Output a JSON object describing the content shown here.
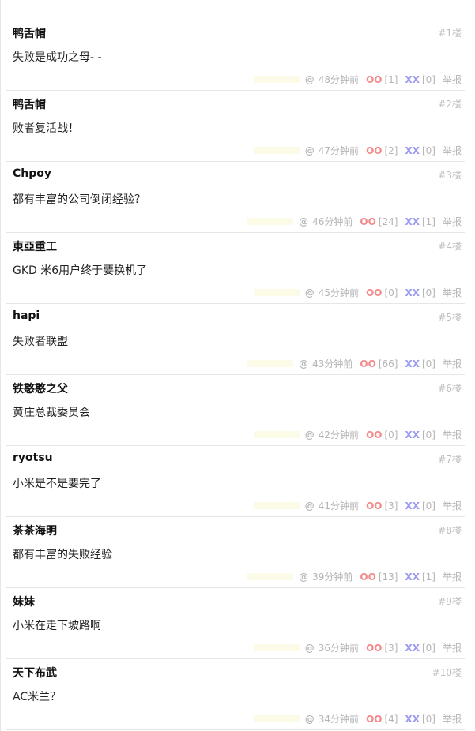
{
  "labels": {
    "report": "举报",
    "at": "@",
    "oo": "OO",
    "xx": "XX"
  },
  "comments": [
    {
      "author": "鸭舌帽",
      "floor": "#1楼",
      "content": "失败是成功之母- -",
      "time": "48分钟前",
      "oo": "[1]",
      "xx": "[0]"
    },
    {
      "author": "鸭舌帽",
      "floor": "#2楼",
      "content": "败者复活战！",
      "time": "47分钟前",
      "oo": "[2]",
      "xx": "[0]"
    },
    {
      "author": "Chpoy",
      "floor": "#3楼",
      "content": "都有丰富的公司倒闭经验？",
      "time": "46分钟前",
      "oo": "[24]",
      "xx": "[1]"
    },
    {
      "author": "東亞重工",
      "floor": "#4楼",
      "content": "GKD 米6用户终于要换机了",
      "time": "45分钟前",
      "oo": "[0]",
      "xx": "[0]"
    },
    {
      "author": "hapi",
      "floor": "#5楼",
      "content": "失败者联盟",
      "time": "43分钟前",
      "oo": "[66]",
      "xx": "[0]"
    },
    {
      "author": "铁憨憨之父",
      "floor": "#6楼",
      "content": "黄庄总裁委员会",
      "time": "42分钟前",
      "oo": "[0]",
      "xx": "[0]"
    },
    {
      "author": "ryotsu",
      "floor": "#7楼",
      "content": "小米是不是要完了",
      "time": "41分钟前",
      "oo": "[3]",
      "xx": "[0]"
    },
    {
      "author": "茶茶海明",
      "floor": "#8楼",
      "content": "都有丰富的失败经验",
      "time": "39分钟前",
      "oo": "[13]",
      "xx": "[1]"
    },
    {
      "author": "妹妹",
      "floor": "#9楼",
      "content": "小米在走下坡路啊",
      "time": "36分钟前",
      "oo": "[3]",
      "xx": "[0]"
    },
    {
      "author": "天下布武",
      "floor": "#10楼",
      "content": "AC米兰？",
      "time": "34分钟前",
      "oo": "[4]",
      "xx": "[0]"
    }
  ]
}
